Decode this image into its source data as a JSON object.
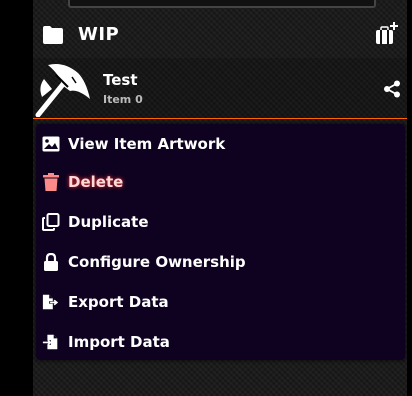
{
  "folder": {
    "name": "WIP"
  },
  "item": {
    "name": "Test",
    "subtitle": "Item 0"
  },
  "context_menu": {
    "items": [
      {
        "label": "View Item Artwork",
        "icon": "image-icon"
      },
      {
        "label": "Delete",
        "icon": "trash-icon"
      },
      {
        "label": "Duplicate",
        "icon": "copy-icon"
      },
      {
        "label": "Configure Ownership",
        "icon": "lock-icon"
      },
      {
        "label": "Export Data",
        "icon": "file-export-icon"
      },
      {
        "label": "Import Data",
        "icon": "file-import-icon"
      }
    ]
  },
  "colors": {
    "accent": "#ff6400",
    "menu_bg": "#0e0220",
    "danger_glow": "#ff3030"
  }
}
